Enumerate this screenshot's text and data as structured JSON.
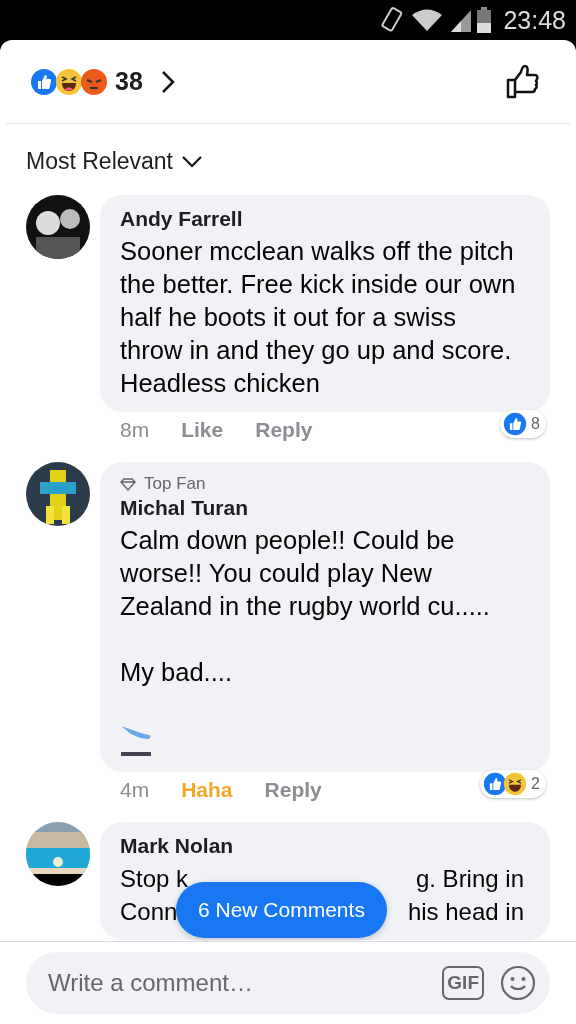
{
  "status_bar": {
    "time": "23:48"
  },
  "header": {
    "reactions": [
      {
        "kind": "like"
      },
      {
        "kind": "haha"
      },
      {
        "kind": "angry"
      }
    ],
    "count": "38"
  },
  "sort": {
    "label": "Most Relevant"
  },
  "comments": [
    {
      "author": "Andy Farrell",
      "paragraphs": [
        {
          "kind": "text",
          "text": "Sooner mcclean walks off the pitch the better. Free kick inside our own half he boots it out for a swiss throw in and they go up and score. Headless chicken"
        }
      ],
      "time": "8m",
      "like_label": "Like",
      "reply_label": "Reply",
      "reactions": {
        "types": [
          {
            "kind": "like"
          }
        ],
        "count": "8"
      }
    },
    {
      "badge": "Top Fan",
      "author": "Michal Turan",
      "paragraphs": [
        {
          "kind": "text",
          "text": "Calm down people!! Could be worse!! You could play New Zealand in the rugby world cu....."
        },
        {
          "kind": "blank"
        },
        {
          "kind": "text",
          "text": "My bad...."
        },
        {
          "kind": "blank"
        },
        {
          "kind": "emoji"
        }
      ],
      "time": "4m",
      "like_label": "Haha",
      "user_reaction": {
        "kind": "haha"
      },
      "reply_label": "Reply",
      "reactions": {
        "types": [
          {
            "kind": "like"
          },
          {
            "kind": "haha"
          }
        ],
        "count": "2"
      }
    },
    {
      "author": "Mark Nolan",
      "obscured_lines": [
        [
          "Stop k",
          "g. Bring in"
        ],
        [
          "Conn",
          "his head in"
        ]
      ]
    }
  ],
  "new_comments": {
    "label": "6 New Comments"
  },
  "composer": {
    "placeholder": "Write a comment…",
    "gif_label": "GIF"
  }
}
